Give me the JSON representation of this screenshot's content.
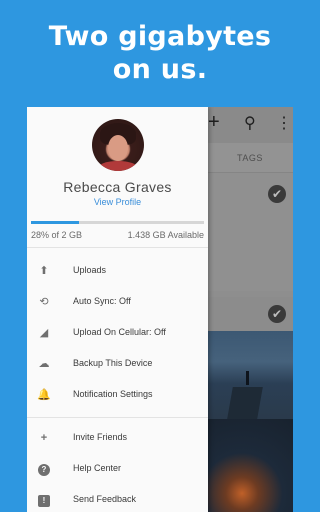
{
  "headline": {
    "line1": "Two gigabytes",
    "line2": "on us."
  },
  "background_app": {
    "toolbar_icons": [
      "plus-icon",
      "search-icon",
      "more-vertical-icon"
    ],
    "toolbar_glyphs": {
      "plus": "+",
      "search": "⚲",
      "more": "⋮"
    },
    "tab_label": "TAGS",
    "check_glyph": "✔"
  },
  "drawer": {
    "user_name": "Rebecca Graves",
    "view_profile": "View Profile",
    "storage": {
      "used_text": "28% of 2 GB",
      "available_text": "1.438 GB Available",
      "used_fraction": 0.28
    },
    "menu_primary": [
      {
        "label": "Uploads",
        "value": "",
        "icon": "upload-icon",
        "glyph": "⬆"
      },
      {
        "label": "Auto Sync: ",
        "value": "Off",
        "icon": "sync-icon",
        "glyph": "⟲"
      },
      {
        "label": "Upload On Cellular: ",
        "value": "Off",
        "icon": "cellular-signal-icon",
        "glyph": "◢"
      },
      {
        "label": "Backup This Device",
        "value": "",
        "icon": "cloud-upload-icon",
        "glyph": "☁"
      },
      {
        "label": "Notification Settings",
        "value": "",
        "icon": "bell-icon",
        "glyph": "🔔"
      }
    ],
    "menu_secondary": [
      {
        "label": "Invite Friends",
        "icon": "add-person-icon",
        "glyph": "+"
      },
      {
        "label": "Help Center",
        "icon": "help-icon",
        "glyph": "?"
      },
      {
        "label": "Send Feedback",
        "icon": "feedback-icon",
        "glyph": "!"
      }
    ]
  },
  "colors": {
    "brand": "#2e97e0",
    "drawer_bg": "#fafafa",
    "link": "#3a8ed9"
  }
}
